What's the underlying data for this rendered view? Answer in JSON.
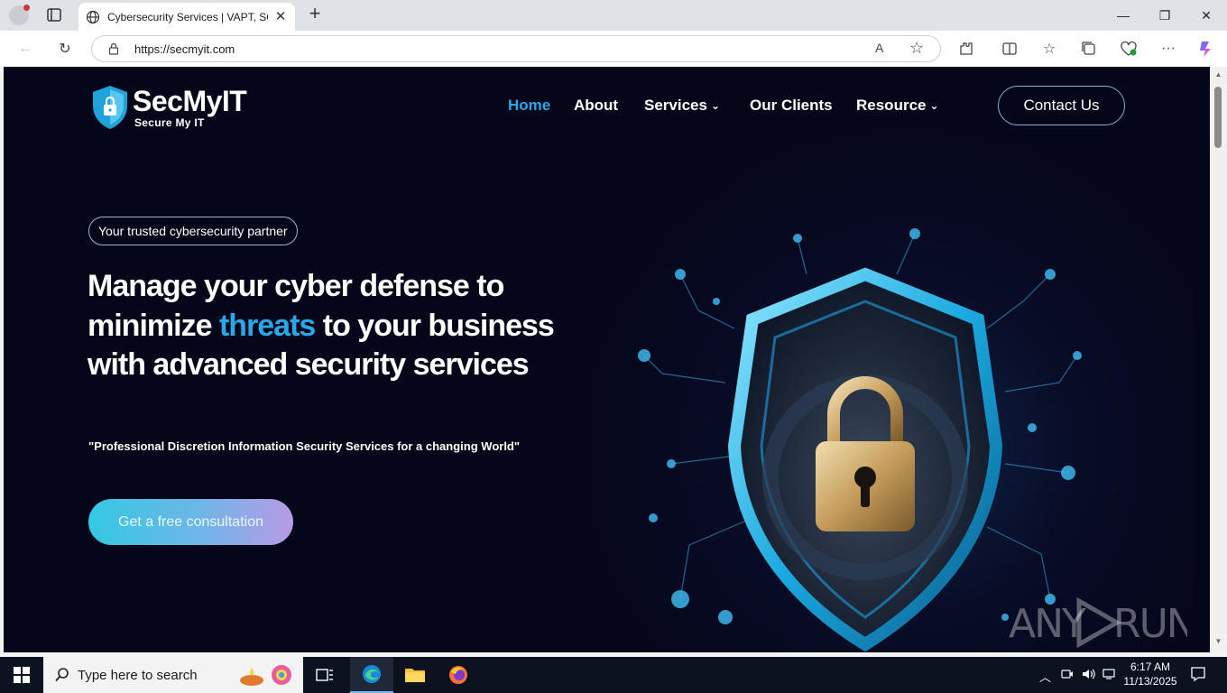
{
  "browser": {
    "tab_title": "Cybersecurity Services | VAPT, SOC",
    "tab_close": "✕",
    "new_tab": "+",
    "url": "https://secmyit.com",
    "read_aloud": "A",
    "favorite": "☆",
    "window_controls": {
      "minimize": "—",
      "restore": "❐",
      "close": "✕"
    }
  },
  "site": {
    "logo_name": "SecMyIT",
    "logo_tagline": "Secure My IT",
    "nav": {
      "home": "Home",
      "about": "About",
      "services": "Services",
      "clients": "Our Clients",
      "resource": "Resource"
    },
    "contact_button": "Contact Us",
    "badge": "Your trusted cybersecurity partner",
    "headline": {
      "part1": "Manage your cyber defense to minimize ",
      "highlight": "threats",
      "part2": " to your business with advanced security services"
    },
    "tagline": "\"Professional Discretion Information Security Services for a changing World\"",
    "cta": "Get a free consultation",
    "accent_color": "#2aa7e6"
  },
  "watermark": "ANY RUN",
  "taskbar": {
    "search_placeholder": "Type here to search",
    "time": "6:17 AM",
    "date": "11/13/2025"
  }
}
